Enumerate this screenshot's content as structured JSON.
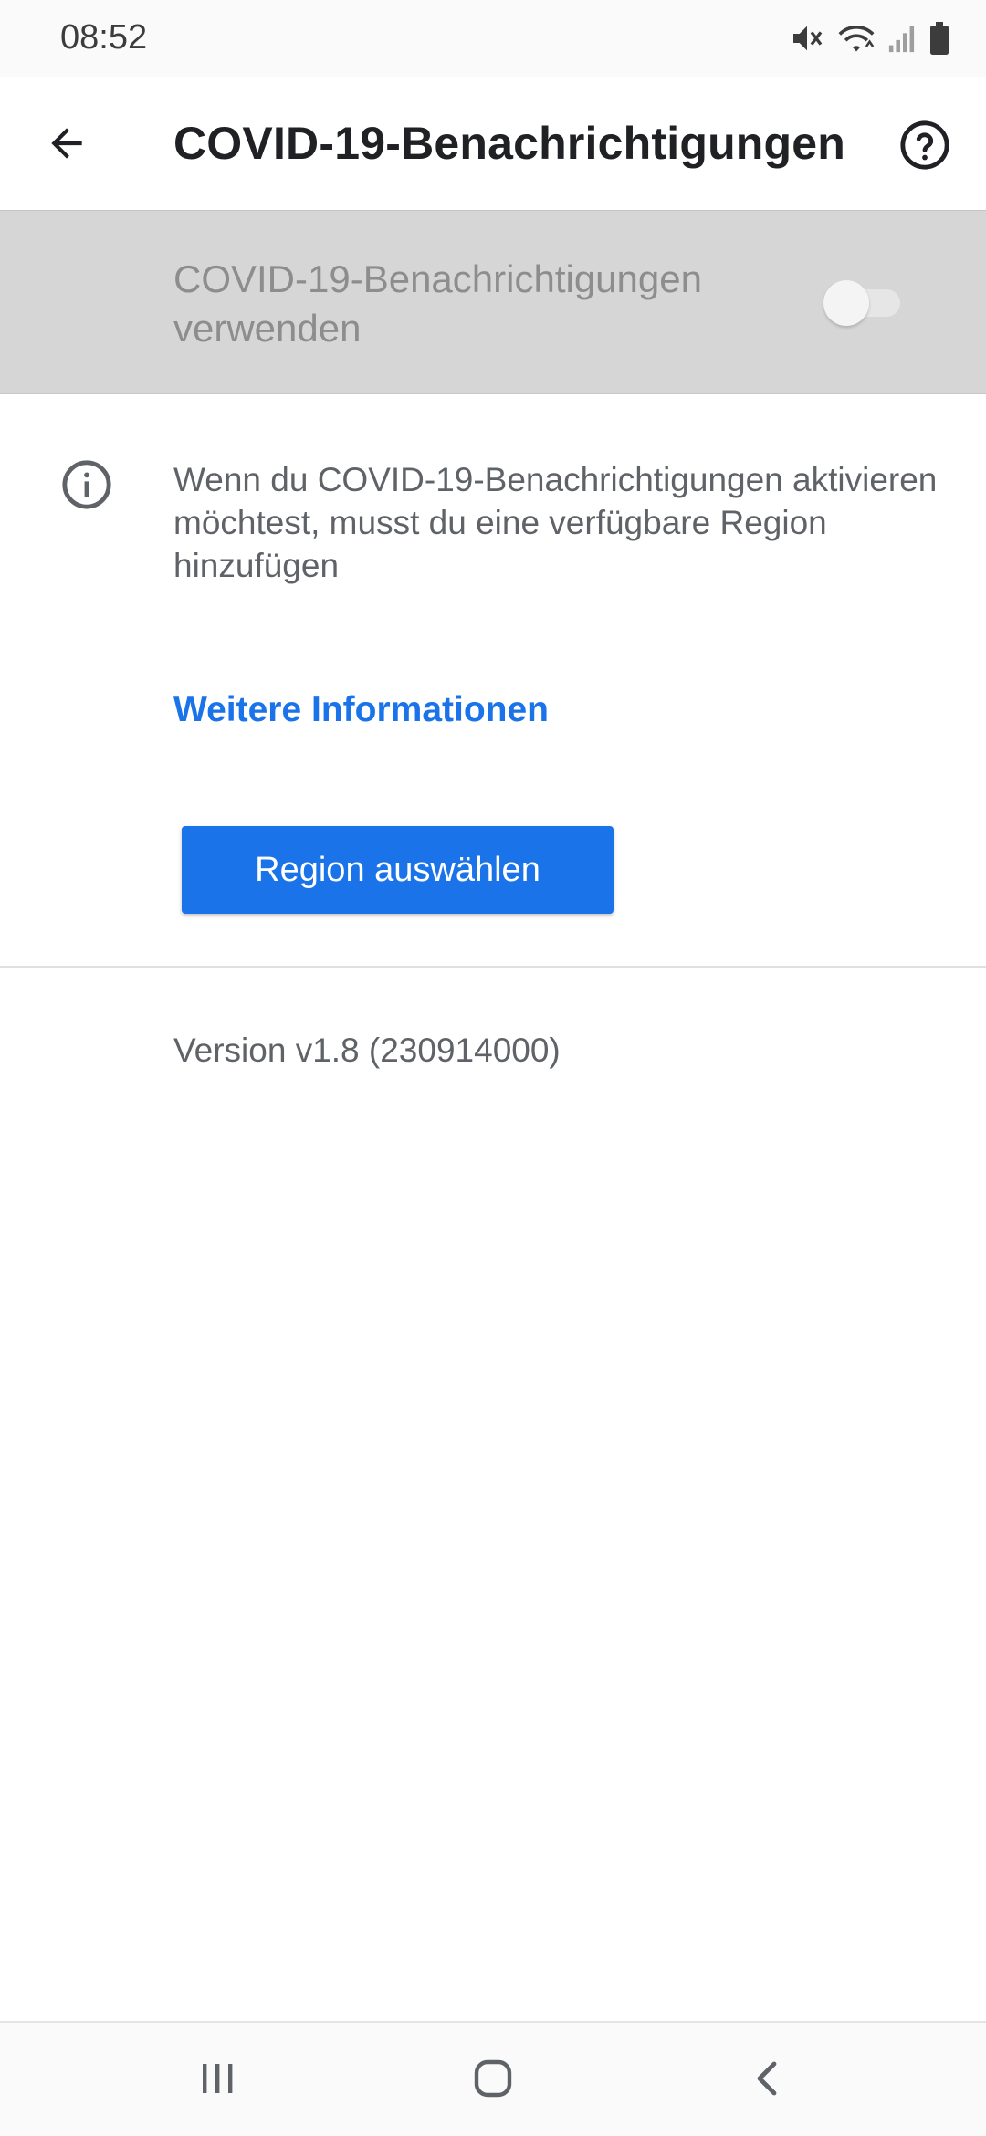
{
  "status_bar": {
    "time": "08:52",
    "icons": [
      "mute-icon",
      "wifi-icon",
      "signal-icon",
      "battery-icon"
    ]
  },
  "app_bar": {
    "title": "COVID-19-Benachrichtigungen",
    "back_icon": "arrow-back-icon",
    "help_icon": "help-circle-icon"
  },
  "toggle": {
    "label": "COVID-19-Benachrichtigungen verwenden",
    "state": "off",
    "enabled": false
  },
  "info": {
    "icon": "info-icon",
    "text": "Wenn du COVID-19-Benachrichtigungen aktivieren möchtest, musst du eine verfügbare Region hinzufügen"
  },
  "links": {
    "more_info": "Weitere Informationen"
  },
  "actions": {
    "select_region": "Region auswählen"
  },
  "footer": {
    "version": "Version v1.8 (230914000)"
  },
  "nav_bar": {
    "items": [
      "recents-icon",
      "home-icon",
      "back-icon"
    ]
  },
  "colors": {
    "accent": "#1a73e8",
    "disabled_row_bg": "#d6d6d6",
    "secondary_text": "#5f6368"
  }
}
